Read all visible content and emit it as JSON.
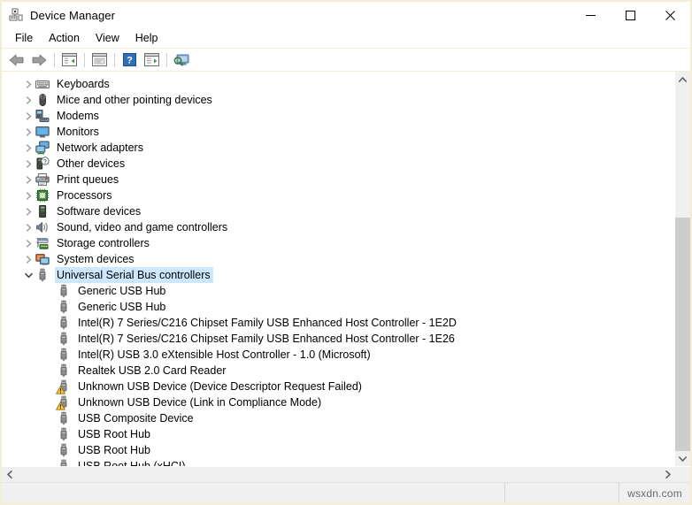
{
  "window": {
    "title": "Device Manager",
    "icon": "device-manager-icon",
    "border_color": "#f2edd3",
    "controls": {
      "minimize": "minimize",
      "maximize": "maximize",
      "close": "close"
    }
  },
  "menubar": {
    "items": [
      {
        "label": "File"
      },
      {
        "label": "Action"
      },
      {
        "label": "View"
      },
      {
        "label": "Help"
      }
    ]
  },
  "toolbar": {
    "buttons": [
      {
        "name": "back-button",
        "icon": "back-arrow-icon"
      },
      {
        "name": "forward-button",
        "icon": "forward-arrow-icon"
      },
      {
        "name": "separator-1",
        "icon": "separator"
      },
      {
        "name": "show-hide-console-tree-button",
        "icon": "console-tree-icon"
      },
      {
        "name": "separator-2",
        "icon": "separator"
      },
      {
        "name": "properties-button",
        "icon": "properties-icon"
      },
      {
        "name": "separator-3",
        "icon": "separator"
      },
      {
        "name": "help-button",
        "icon": "help-icon"
      },
      {
        "name": "update-driver-button",
        "icon": "update-driver-icon"
      },
      {
        "name": "separator-4",
        "icon": "separator"
      },
      {
        "name": "scan-for-hardware-changes-button",
        "icon": "scan-hardware-icon"
      }
    ]
  },
  "tree": {
    "selected_highlight_color": "#cce8ff",
    "items": [
      {
        "label": "Keyboards",
        "icon": "keyboard-icon",
        "level": 1,
        "expanded": false,
        "selected": false,
        "warning": false
      },
      {
        "label": "Mice and other pointing devices",
        "icon": "mouse-icon",
        "level": 1,
        "expanded": false,
        "selected": false,
        "warning": false
      },
      {
        "label": "Modems",
        "icon": "modem-icon",
        "level": 1,
        "expanded": false,
        "selected": false,
        "warning": false
      },
      {
        "label": "Monitors",
        "icon": "monitor-icon",
        "level": 1,
        "expanded": false,
        "selected": false,
        "warning": false
      },
      {
        "label": "Network adapters",
        "icon": "network-adapter-icon",
        "level": 1,
        "expanded": false,
        "selected": false,
        "warning": false
      },
      {
        "label": "Other devices",
        "icon": "other-devices-icon",
        "level": 1,
        "expanded": false,
        "selected": false,
        "warning": false
      },
      {
        "label": "Print queues",
        "icon": "printer-icon",
        "level": 1,
        "expanded": false,
        "selected": false,
        "warning": false
      },
      {
        "label": "Processors",
        "icon": "processor-icon",
        "level": 1,
        "expanded": false,
        "selected": false,
        "warning": false
      },
      {
        "label": "Software devices",
        "icon": "software-device-icon",
        "level": 1,
        "expanded": false,
        "selected": false,
        "warning": false
      },
      {
        "label": "Sound, video and game controllers",
        "icon": "sound-icon",
        "level": 1,
        "expanded": false,
        "selected": false,
        "warning": false
      },
      {
        "label": "Storage controllers",
        "icon": "storage-controller-icon",
        "level": 1,
        "expanded": false,
        "selected": false,
        "warning": false
      },
      {
        "label": "System devices",
        "icon": "system-devices-icon",
        "level": 1,
        "expanded": false,
        "selected": false,
        "warning": false
      },
      {
        "label": "Universal Serial Bus controllers",
        "icon": "usb-icon",
        "level": 1,
        "expanded": true,
        "selected": true,
        "warning": false
      },
      {
        "label": "Generic USB Hub",
        "icon": "usb-icon",
        "level": 2,
        "expanded": null,
        "selected": false,
        "warning": false
      },
      {
        "label": "Generic USB Hub",
        "icon": "usb-icon",
        "level": 2,
        "expanded": null,
        "selected": false,
        "warning": false
      },
      {
        "label": "Intel(R) 7 Series/C216 Chipset Family USB Enhanced Host Controller - 1E2D",
        "icon": "usb-icon",
        "level": 2,
        "expanded": null,
        "selected": false,
        "warning": false
      },
      {
        "label": "Intel(R) 7 Series/C216 Chipset Family USB Enhanced Host Controller - 1E26",
        "icon": "usb-icon",
        "level": 2,
        "expanded": null,
        "selected": false,
        "warning": false
      },
      {
        "label": "Intel(R) USB 3.0 eXtensible Host Controller - 1.0 (Microsoft)",
        "icon": "usb-icon",
        "level": 2,
        "expanded": null,
        "selected": false,
        "warning": false
      },
      {
        "label": "Realtek USB 2.0 Card Reader",
        "icon": "usb-icon",
        "level": 2,
        "expanded": null,
        "selected": false,
        "warning": false
      },
      {
        "label": "Unknown USB Device (Device Descriptor Request Failed)",
        "icon": "usb-icon",
        "level": 2,
        "expanded": null,
        "selected": false,
        "warning": true
      },
      {
        "label": "Unknown USB Device (Link in Compliance Mode)",
        "icon": "usb-icon",
        "level": 2,
        "expanded": null,
        "selected": false,
        "warning": true
      },
      {
        "label": "USB Composite Device",
        "icon": "usb-icon",
        "level": 2,
        "expanded": null,
        "selected": false,
        "warning": false
      },
      {
        "label": "USB Root Hub",
        "icon": "usb-icon",
        "level": 2,
        "expanded": null,
        "selected": false,
        "warning": false
      },
      {
        "label": "USB Root Hub",
        "icon": "usb-icon",
        "level": 2,
        "expanded": null,
        "selected": false,
        "warning": false
      },
      {
        "label": "USB Root Hub (xHCI)",
        "icon": "usb-icon",
        "level": 2,
        "expanded": null,
        "selected": false,
        "warning": false
      }
    ]
  },
  "scrollbar": {
    "vertical": {
      "up_arrow": "scroll-up-arrow-icon",
      "down_arrow": "scroll-down-arrow-icon",
      "thumb_top_percent": 36,
      "thumb_height_percent": 64
    }
  },
  "statusbar": {
    "pane1": "",
    "pane2": "",
    "watermark": "wsxdn.com"
  }
}
